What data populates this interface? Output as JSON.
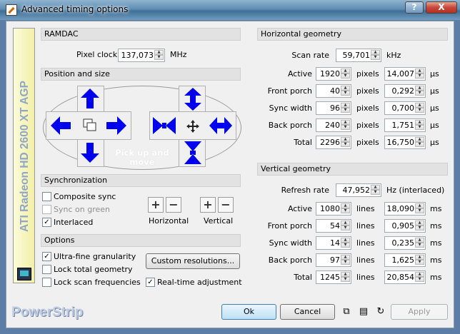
{
  "window": {
    "title": "Advanced timing options",
    "help": "?",
    "close": "X"
  },
  "sidebar": {
    "device": "ATI Radeon HD 2600 XT AGP",
    "brand": "PowerStrip"
  },
  "ramdac": {
    "header": "RAMDAC",
    "pixel_clock_label": "Pixel clock",
    "pixel_clock": "137,073",
    "unit": "MHz"
  },
  "position": {
    "header": "Position and size",
    "pick_text_1": "Pick up and",
    "pick_text_2": "move"
  },
  "sync": {
    "header": "Synchronization",
    "composite": "Composite sync",
    "composite_checked": false,
    "sync_on_green": "Sync on green",
    "sync_on_green_checked": false,
    "interlaced": "Interlaced",
    "interlaced_checked": true,
    "horizontal": "Horizontal",
    "vertical": "Vertical"
  },
  "options": {
    "header": "Options",
    "ultra_fine": "Ultra-fine granularity",
    "ultra_fine_checked": true,
    "lock_total": "Lock total geometry",
    "lock_total_checked": false,
    "lock_scan": "Lock scan frequencies",
    "lock_scan_checked": false,
    "custom_button": "Custom resolutions...",
    "realtime": "Real-time adjustment",
    "realtime_checked": true
  },
  "horizontal": {
    "header": "Horizontal geometry",
    "scan_rate_label": "Scan rate",
    "scan_rate": "59,701",
    "scan_rate_unit": "kHz",
    "rows": [
      {
        "label": "Active",
        "value": "1920",
        "unit": "pixels",
        "time": "14,007",
        "time_unit": "µs"
      },
      {
        "label": "Front porch",
        "value": "40",
        "unit": "pixels",
        "time": "0,292",
        "time_unit": "µs"
      },
      {
        "label": "Sync width",
        "value": "96",
        "unit": "pixels",
        "time": "0,700",
        "time_unit": "µs"
      },
      {
        "label": "Back porch",
        "value": "240",
        "unit": "pixels",
        "time": "1,751",
        "time_unit": "µs"
      },
      {
        "label": "Total",
        "value": "2296",
        "unit": "pixels",
        "time": "16,750",
        "time_unit": "µs"
      }
    ]
  },
  "vertical": {
    "header": "Vertical geometry",
    "refresh_label": "Refresh rate",
    "refresh": "47,952",
    "refresh_unit": "Hz (interlaced)",
    "rows": [
      {
        "label": "Active",
        "value": "1080",
        "unit": "lines",
        "time": "18,090",
        "time_unit": "ms"
      },
      {
        "label": "Front porch",
        "value": "54",
        "unit": "lines",
        "time": "0,905",
        "time_unit": "ms"
      },
      {
        "label": "Sync width",
        "value": "14",
        "unit": "lines",
        "time": "0,235",
        "time_unit": "ms"
      },
      {
        "label": "Back porch",
        "value": "97",
        "unit": "lines",
        "time": "1,625",
        "time_unit": "ms"
      },
      {
        "label": "Total",
        "value": "1245",
        "unit": "lines",
        "time": "20,854",
        "time_unit": "ms"
      }
    ]
  },
  "footer": {
    "ok": "Ok",
    "cancel": "Cancel",
    "apply": "Apply"
  },
  "colors": {
    "arrow": "#0000ee",
    "accent": "#3c7fb1"
  }
}
